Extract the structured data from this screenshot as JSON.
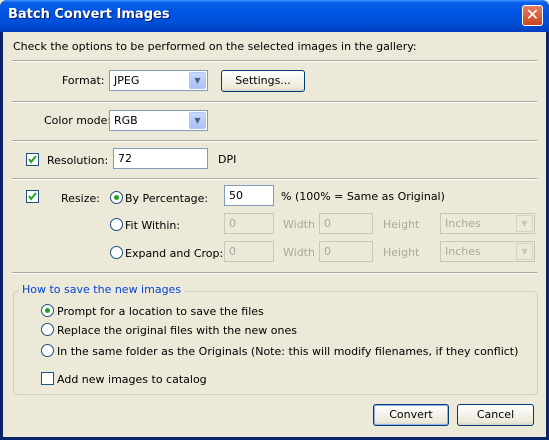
{
  "window": {
    "title": "Batch Convert Images",
    "close_glyph": "✕"
  },
  "instructions": "Check the options to be performed on the selected images in the gallery:",
  "format": {
    "label": "Format:",
    "value": "JPEG",
    "settings_button": "Settings..."
  },
  "color_mode": {
    "label": "Color mode:",
    "value": "RGB"
  },
  "resolution": {
    "checked": true,
    "label": "Resolution:",
    "value": "72",
    "unit": "DPI"
  },
  "resize": {
    "checked": true,
    "label": "Resize:",
    "by_percentage": {
      "label": "By Percentage:",
      "value": "50",
      "note": "% (100% = Same as Original)",
      "selected": true
    },
    "fit_within": {
      "label": "Fit Within:",
      "width_value": "0",
      "width_label": "Width",
      "height_value": "0",
      "height_label": "Height",
      "unit": "Inches",
      "selected": false
    },
    "expand_crop": {
      "label": "Expand and Crop:",
      "width_value": "0",
      "width_label": "Width",
      "height_value": "0",
      "height_label": "Height",
      "unit": "Inches",
      "selected": false
    }
  },
  "save_group": {
    "title": "How to save the new images",
    "options": [
      {
        "label": "Prompt for a location to save the files",
        "selected": true
      },
      {
        "label": "Replace the original files with the new ones",
        "selected": false
      },
      {
        "label": "In the same folder as the Originals (Note: this will modify filenames, if they conflict)",
        "selected": false
      }
    ],
    "add_to_catalog": {
      "label": "Add new images to catalog",
      "checked": false
    }
  },
  "buttons": {
    "convert": "Convert",
    "cancel": "Cancel"
  },
  "colors": {
    "title_bar": "#0054e3",
    "dialog_bg": "#ece9d8",
    "group_title": "#0046d5",
    "radio_dot": "#21a121"
  }
}
